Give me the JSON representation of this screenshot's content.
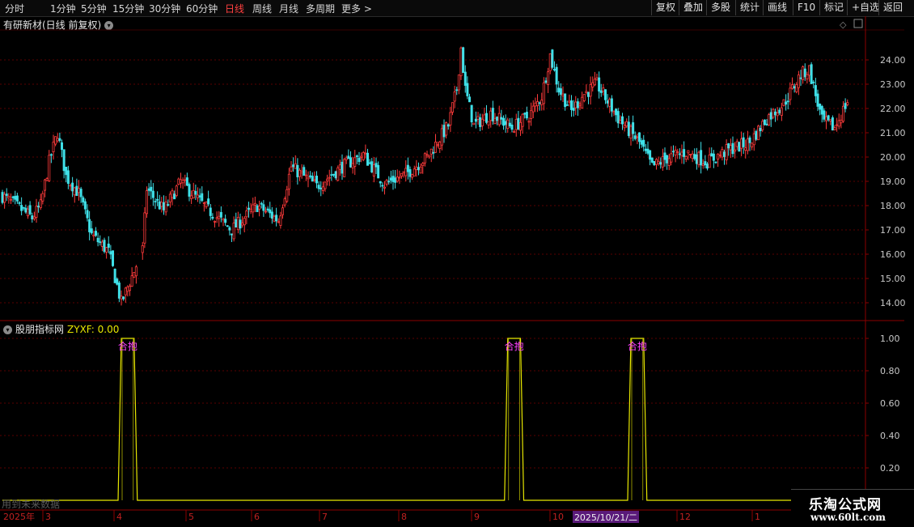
{
  "toolbar": {
    "periods": [
      "分时",
      "1分钟",
      "5分钟",
      "15分钟",
      "30分钟",
      "60分钟",
      "日线",
      "周线",
      "月线",
      "多周期",
      "更多 >"
    ],
    "active_period": "日线",
    "right_buttons": [
      "复权",
      "叠加",
      "多股",
      "统计",
      "画线",
      "F10",
      "标记",
      "+自选",
      "返回"
    ]
  },
  "main_title": "有研新材(日线 前复权)",
  "indicator": {
    "name": "股朋指标网",
    "value_label": "ZYXF: 0.00"
  },
  "watermark": "用到未来数据",
  "logo": {
    "cn": "乐淘公式网",
    "url": "www.60lt.com"
  },
  "colors": {
    "up": "#ff3b3b",
    "down": "#3fe0e8",
    "signal": "#e8e800",
    "grid": "#5a0000",
    "axis": "#8b0000"
  },
  "chart_data": [
    {
      "type": "candlestick",
      "yticks": [
        "24.00",
        "23.00",
        "22.00",
        "21.00",
        "20.00",
        "19.00",
        "18.00",
        "17.00",
        "16.00",
        "15.00",
        "14.00"
      ],
      "ylim": [
        13.3,
        25.2
      ],
      "keypoints": [
        [
          0,
          18.4
        ],
        [
          8,
          17.9
        ],
        [
          14,
          17.5
        ],
        [
          18,
          18.0
        ],
        [
          22,
          19.8
        ],
        [
          26,
          21.0
        ],
        [
          30,
          19.2
        ],
        [
          36,
          18.5
        ],
        [
          42,
          16.8
        ],
        [
          50,
          16.1
        ],
        [
          56,
          14.0
        ],
        [
          62,
          15.3
        ],
        [
          66,
          16.2
        ],
        [
          68,
          18.7
        ],
        [
          76,
          17.8
        ],
        [
          84,
          19.0
        ],
        [
          96,
          17.9
        ],
        [
          108,
          17.0
        ],
        [
          120,
          18.0
        ],
        [
          130,
          17.4
        ],
        [
          136,
          19.6
        ],
        [
          148,
          18.8
        ],
        [
          160,
          19.6
        ],
        [
          170,
          20.1
        ],
        [
          180,
          18.9
        ],
        [
          190,
          19.3
        ],
        [
          200,
          20.0
        ],
        [
          210,
          21.3
        ],
        [
          214,
          22.8
        ],
        [
          216,
          24.5
        ],
        [
          218,
          22.8
        ],
        [
          222,
          21.3
        ],
        [
          230,
          21.8
        ],
        [
          240,
          21.2
        ],
        [
          248,
          21.7
        ],
        [
          254,
          22.5
        ],
        [
          258,
          24.2
        ],
        [
          262,
          22.8
        ],
        [
          268,
          21.9
        ],
        [
          274,
          22.6
        ],
        [
          280,
          23.0
        ],
        [
          290,
          21.6
        ],
        [
          300,
          20.6
        ],
        [
          306,
          19.6
        ],
        [
          314,
          20.0
        ],
        [
          322,
          20.2
        ],
        [
          332,
          19.8
        ],
        [
          342,
          20.3
        ],
        [
          352,
          20.6
        ],
        [
          360,
          21.6
        ],
        [
          368,
          22.2
        ],
        [
          376,
          23.4
        ],
        [
          380,
          23.6
        ],
        [
          386,
          21.5
        ],
        [
          392,
          21.2
        ],
        [
          398,
          22.3
        ]
      ],
      "first_year_label": "2025年",
      "month_labels": [
        "3",
        "4",
        "5",
        "6",
        "7",
        "8",
        "9",
        "10",
        "12",
        "1"
      ],
      "cursor_date": "2025/10/21/二"
    },
    {
      "type": "line",
      "series_name": "ZYXF",
      "yticks": [
        "1.00",
        "0.80",
        "0.60",
        "0.40",
        "0.20"
      ],
      "ylim": [
        -0.05,
        1.05
      ],
      "pulses": [
        {
          "start": 56,
          "end": 62,
          "label": "合抱"
        },
        {
          "start": 238,
          "end": 244,
          "label": "合抱"
        },
        {
          "start": 296,
          "end": 302,
          "label": "合抱"
        }
      ]
    }
  ]
}
